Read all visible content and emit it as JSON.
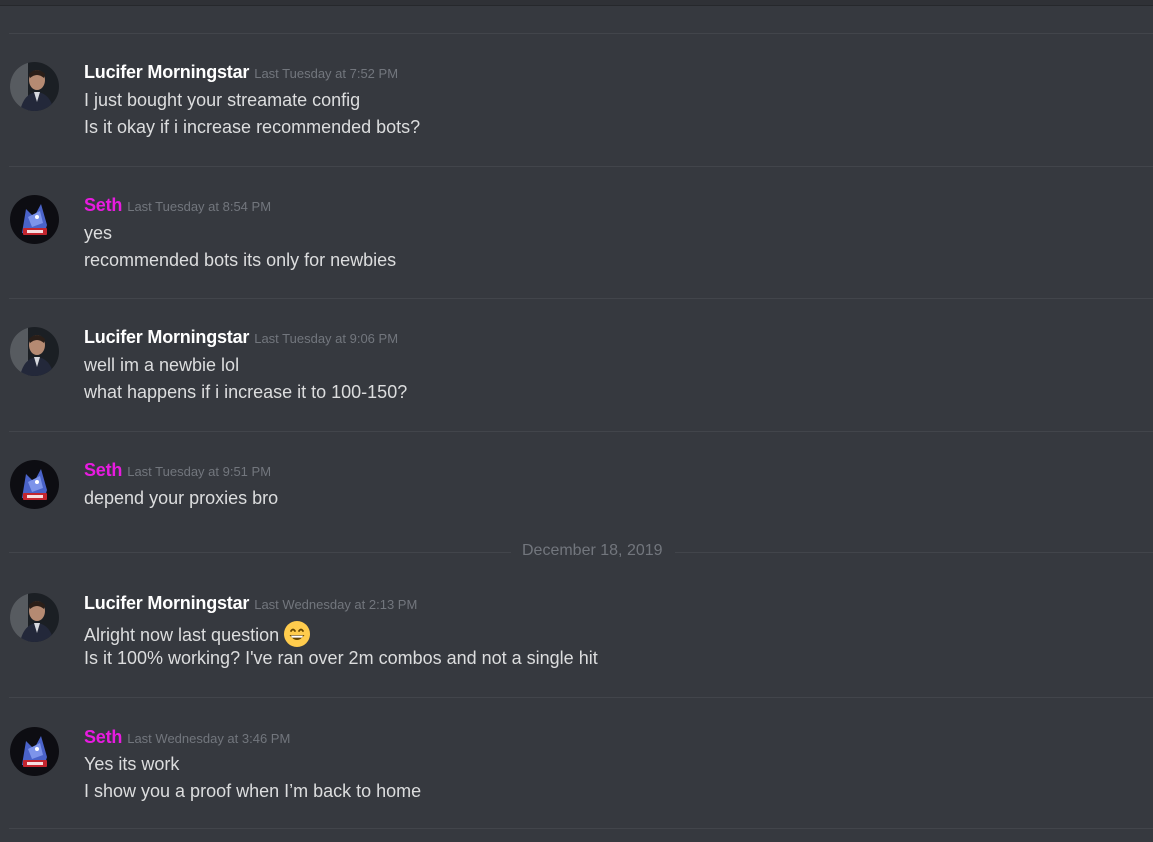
{
  "theme": {
    "background": "#36393f",
    "username_default_color": "#ffffff",
    "username_seth_color": "#e81be0",
    "timestamp_color": "#72767d",
    "text_color": "#dcddde",
    "divider_color": "#42454b"
  },
  "messages": [
    {
      "author": "Lucifer Morningstar",
      "timestamp": "Last Tuesday at 7:52 PM",
      "lines": [
        "I just bought your streamate config",
        "Is it okay if i increase recommended bots?"
      ]
    },
    {
      "author": "Seth",
      "timestamp": "Last Tuesday at 8:54 PM",
      "lines": [
        "yes",
        "recommended bots its only for newbies"
      ]
    },
    {
      "author": "Lucifer Morningstar",
      "timestamp": "Last Tuesday at 9:06 PM",
      "lines": [
        "well im a newbie lol",
        "what happens if i increase it to 100-150?"
      ]
    },
    {
      "author": "Seth",
      "timestamp": "Last Tuesday at 9:51 PM",
      "lines": [
        "depend your proxies bro"
      ]
    },
    {
      "author": "Lucifer Morningstar",
      "timestamp": "Last Wednesday at 2:13 PM",
      "lines": [
        "Alright now last question",
        "Is it 100% working? I've ran over 2m combos and not a single hit"
      ],
      "emoji": "grinning-face-emoji"
    },
    {
      "author": "Seth",
      "timestamp": "Last Wednesday at 3:46 PM",
      "lines": [
        "Yes its work",
        "I show you a proof when I’m back to home"
      ]
    }
  ],
  "date_separator": "December 18, 2019"
}
